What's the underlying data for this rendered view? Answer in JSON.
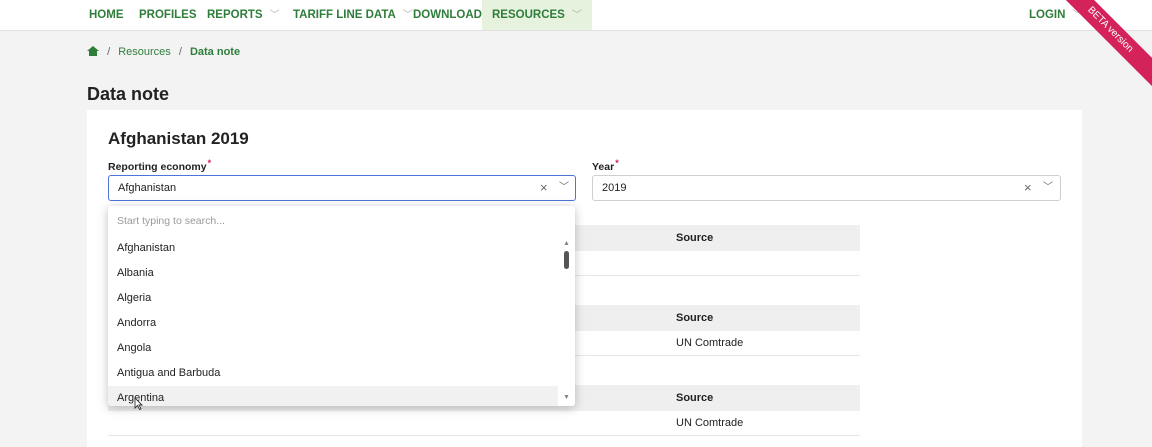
{
  "nav": {
    "items": [
      {
        "label": "HOME",
        "dropdown": false
      },
      {
        "label": "PROFILES",
        "dropdown": false
      },
      {
        "label": "REPORTS",
        "dropdown": true
      },
      {
        "label": "TARIFF LINE DATA",
        "dropdown": true
      },
      {
        "label": "DOWNLOAD",
        "dropdown": false
      },
      {
        "label": "RESOURCES",
        "dropdown": true,
        "active": true
      }
    ],
    "login": "LOGIN",
    "beta": "BETA version"
  },
  "breadcrumb": {
    "home_icon": "home-icon",
    "separator": "/",
    "resources": "Resources",
    "current": "Data note"
  },
  "page_title": "Data note",
  "card": {
    "title": "Afghanistan 2019",
    "reporting_economy": {
      "label": "Reporting economy",
      "required_mark": "*",
      "value": "Afghanistan"
    },
    "year": {
      "label": "Year",
      "required_mark": "*",
      "value": "2019"
    },
    "clear_glyph": "×",
    "chevron_glyph": "﹀",
    "tables": [
      {
        "header": "Source",
        "rows": [
          ""
        ]
      },
      {
        "header": "Source",
        "rows": [
          "UN Comtrade"
        ]
      },
      {
        "header": "Source",
        "rows": [
          "UN Comtrade"
        ]
      }
    ]
  },
  "dropdown": {
    "placeholder": "Start typing to search...",
    "options": [
      "Afghanistan",
      "Albania",
      "Algeria",
      "Andorra",
      "Angola",
      "Antigua and Barbuda",
      "Argentina"
    ],
    "hovered_index": 6
  },
  "colors": {
    "brand_green": "#2f7d3a",
    "focus_blue": "#4d75d6",
    "required_red": "#d3235a",
    "beta_ribbon": "#d3235a"
  }
}
